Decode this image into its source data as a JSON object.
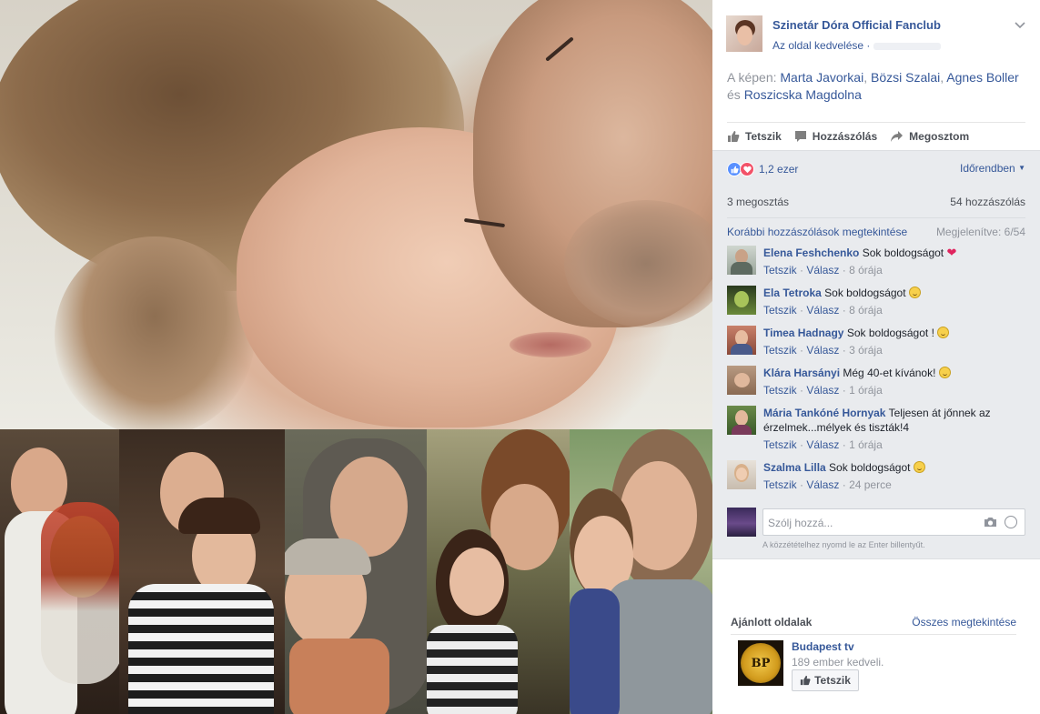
{
  "post": {
    "page_name": "Szinetár Dóra Official Fanclub",
    "like_page": "Az oldal kedvelése ·",
    "caption_prefix": "A képen: ",
    "tags": [
      "Marta Javorkai",
      "Bözsi Szalai",
      "Agnes Boller",
      "Roszicska Magdolna"
    ],
    "caption_and": " és ",
    "actions": {
      "like": "Tetszik",
      "comment": "Hozzászólás",
      "share": "Megosztom"
    }
  },
  "stats": {
    "reactions_count": "1,2 ezer",
    "sort_label": "Időrendben",
    "shares": "3 megosztás",
    "comments_count": "54 hozzászólás",
    "previous_comments": "Korábbi hozzászólások megtekintése",
    "showing": "Megjelenítve: 6/54"
  },
  "comments": [
    {
      "name": "Elena Feshchenko",
      "text": "Sok boldogságot",
      "emoji": "heart",
      "like": "Tetszik",
      "reply": "Válasz",
      "time": "8 órája"
    },
    {
      "name": "Ela Tetroka",
      "text": "Sok boldogságot",
      "emoji": "smile",
      "like": "Tetszik",
      "reply": "Válasz",
      "time": "8 órája"
    },
    {
      "name": "Timea Hadnagy",
      "text": "Sok boldogságot !",
      "emoji": "smile",
      "like": "Tetszik",
      "reply": "Válasz",
      "time": "3 órája"
    },
    {
      "name": "Klára Harsányi",
      "text": "Még 40-et kívánok!",
      "emoji": "smile",
      "like": "Tetszik",
      "reply": "Válasz",
      "time": "1 órája"
    },
    {
      "name": "Mária Tankóné Hornyak",
      "text": "Teljesen át jőnnek az érzelmek...mélyek és tiszták!4",
      "emoji": "",
      "like": "Tetszik",
      "reply": "Válasz",
      "time": "1 órája"
    },
    {
      "name": "Szalma Lilla",
      "text": "Sok boldogságot",
      "emoji": "smile",
      "like": "Tetszik",
      "reply": "Válasz",
      "time": "24 perce"
    }
  ],
  "composer": {
    "placeholder": "Szólj hozzá...",
    "hint": "A közzétételhez nyomd le az Enter billentyűt."
  },
  "suggested": {
    "title": "Ajánlott oldalak",
    "see_all": "Összes megtekintése",
    "page_name": "Budapest tv",
    "likes": "189 ember kedveli.",
    "button": "Tetszik",
    "logo_text": "BP"
  },
  "colors": {
    "link": "#365899",
    "muted": "#90949c",
    "like_blue": "#5890ff",
    "love_red": "#f25268"
  }
}
